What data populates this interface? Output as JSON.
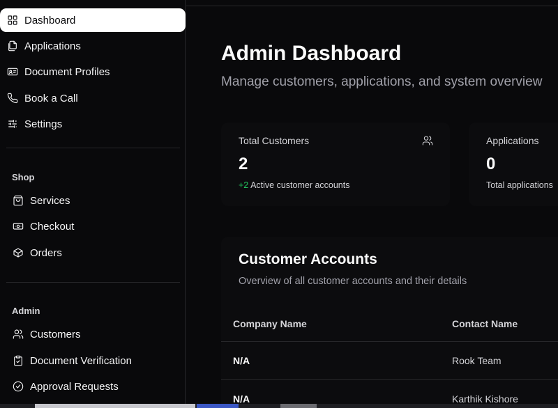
{
  "sidebar": {
    "top_items": [
      {
        "label": "Dashboard",
        "icon": "grid-icon",
        "active": true
      },
      {
        "label": "Applications",
        "icon": "files-icon"
      },
      {
        "label": "Document Profiles",
        "icon": "id-card-icon"
      },
      {
        "label": "Book a Call",
        "icon": "phone-icon"
      },
      {
        "label": "Settings",
        "icon": "sliders-icon"
      }
    ],
    "shop": {
      "label": "Shop",
      "items": [
        {
          "label": "Services",
          "icon": "shopping-bag-icon"
        },
        {
          "label": "Checkout",
          "icon": "banknote-icon"
        },
        {
          "label": "Orders",
          "icon": "package-icon"
        }
      ]
    },
    "admin": {
      "label": "Admin",
      "items": [
        {
          "label": "Customers",
          "icon": "users-icon"
        },
        {
          "label": "Document Verification",
          "icon": "clipboard-check-icon"
        },
        {
          "label": "Approval Requests",
          "icon": "check-circle-icon"
        }
      ]
    }
  },
  "main": {
    "title": "Admin Dashboard",
    "subtitle": "Manage customers, applications, and system overview",
    "stats": [
      {
        "label": "Total Customers",
        "value": "2",
        "delta": "+2",
        "note": "Active customer accounts",
        "icon": "users-icon"
      },
      {
        "label": "Applications",
        "value": "0",
        "note": "Total applications"
      }
    ],
    "accounts": {
      "title": "Customer Accounts",
      "subtitle": "Overview of all customer accounts and their details",
      "columns": [
        "Company Name",
        "Contact Name"
      ],
      "rows": [
        {
          "company": "N/A",
          "contact": "Rook Team"
        },
        {
          "company": "N/A",
          "contact": "Karthik Kishore"
        }
      ]
    }
  },
  "colors": {
    "background": "#09090b",
    "active_bg": "#ffffff",
    "positive": "#22c55e",
    "muted_text": "#a1a1aa",
    "border": "#27272a"
  }
}
